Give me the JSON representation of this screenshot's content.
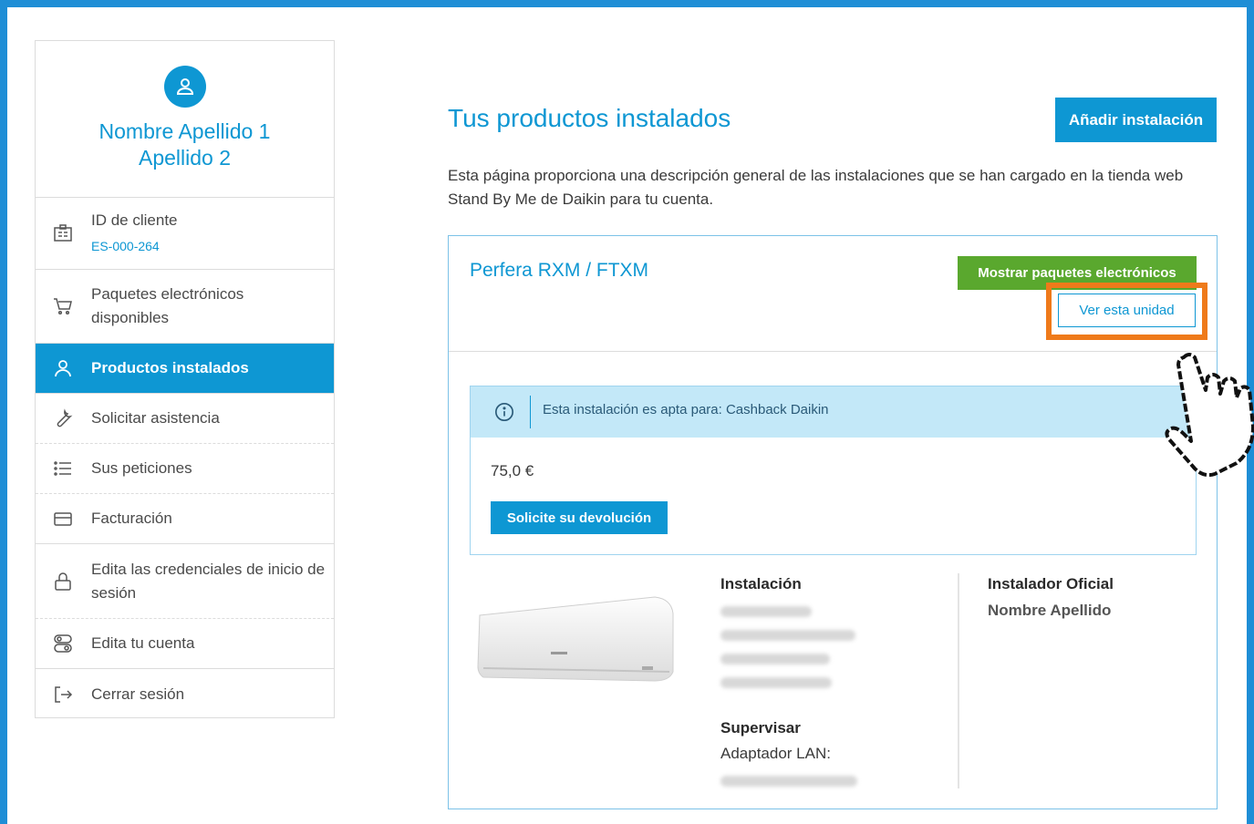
{
  "profile": {
    "name": "Nombre Apellido 1 Apellido 2"
  },
  "sidebar": {
    "items": [
      {
        "label": "ID de cliente",
        "sub": "ES-000-264",
        "icon": "id-card-icon"
      },
      {
        "label": "Paquetes electrónicos disponibles",
        "icon": "cart-icon"
      },
      {
        "label": "Productos instalados",
        "icon": "user-icon",
        "active": true
      },
      {
        "label": "Solicitar asistencia",
        "icon": "wrench-icon"
      },
      {
        "label": "Sus peticiones",
        "icon": "list-icon"
      },
      {
        "label": "Facturación",
        "icon": "credit-card-icon"
      },
      {
        "label": "Edita las credenciales de inicio de sesión",
        "icon": "lock-icon"
      },
      {
        "label": "Edita tu cuenta",
        "icon": "toggle-icon"
      },
      {
        "label": "Cerrar sesión",
        "icon": "logout-icon"
      }
    ]
  },
  "main": {
    "title": "Tus productos instalados",
    "add_button": "Añadir instalación",
    "intro": "Esta página proporciona una descripción general de las instalaciones que se han cargado en la tienda web Stand By Me de Daikin para tu cuenta."
  },
  "card": {
    "title": "Perfera RXM / FTXM",
    "show_packages_button": "Mostrar paquetes electrónicos",
    "view_unit_button": "Ver esta unidad",
    "cashback_text": "Esta instalación es apta para: Cashback Daikin",
    "amount": "75,0 €",
    "refund_button": "Solicite su devolución",
    "installation_heading": "Instalación",
    "supervise_heading": "Supervisar",
    "lan_label": "Adaptador LAN:",
    "installer_heading": "Instalador Oficial",
    "installer_name": "Nombre Apellido"
  },
  "colors": {
    "accent": "#0e97d3",
    "green": "#5aa82e",
    "highlight": "#ef7a1a",
    "info_band": "#c3e8f8"
  }
}
